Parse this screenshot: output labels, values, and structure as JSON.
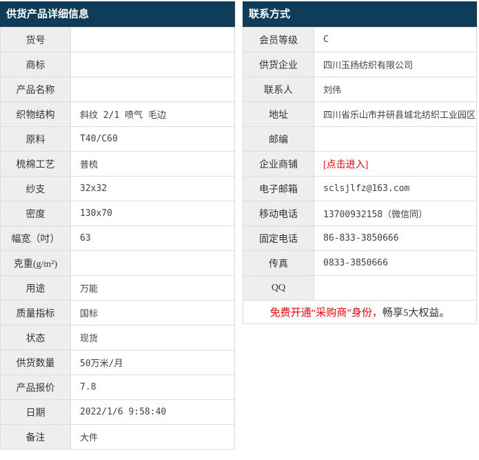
{
  "colors": {
    "header_bg": "#0d3d58",
    "accent_red": "#e60000",
    "label_bg": "#eeeeee",
    "border": "#dcdcdc"
  },
  "left_panel": {
    "title": "供货产品详细信息",
    "rows": [
      {
        "label": "货号",
        "value": ""
      },
      {
        "label": "商标",
        "value": ""
      },
      {
        "label": "产品名称",
        "value": ""
      },
      {
        "label": "织物结构",
        "value": "斜纹 2/1 喷气 毛边"
      },
      {
        "label": "原料",
        "value": "T40/C60"
      },
      {
        "label": "梳棉工艺",
        "value": "普梳"
      },
      {
        "label": "纱支",
        "value": "32x32"
      },
      {
        "label": "密度",
        "value": "130x70"
      },
      {
        "label": "幅宽（吋）",
        "value": "63"
      },
      {
        "label": "克重(g/m²)",
        "value": ""
      },
      {
        "label": "用途",
        "value": "万能"
      },
      {
        "label": "质量指标",
        "value": "国标"
      },
      {
        "label": "状态",
        "value": "现货"
      },
      {
        "label": "供货数量",
        "value": "50万米/月"
      },
      {
        "label": "产品报价",
        "value": "7.8"
      },
      {
        "label": "日期",
        "value": "2022/1/6 9:58:40"
      },
      {
        "label": "备注",
        "value": "大件"
      }
    ]
  },
  "right_panel": {
    "title": "联系方式",
    "rows": [
      {
        "label": "会员等级",
        "value": "C"
      },
      {
        "label": "供货企业",
        "value": "四川玉扬纺织有限公司"
      },
      {
        "label": "联系人",
        "value": "刘伟"
      },
      {
        "label": "地址",
        "value": "四川省乐山市井研县城北纺织工业园区"
      },
      {
        "label": "邮编",
        "value": ""
      },
      {
        "label": "企业商铺",
        "value": "[点击进入]"
      },
      {
        "label": "电子邮箱",
        "value": "sclsjlfz@163.com"
      },
      {
        "label": "移动电话",
        "value": "13700932158（微信同）"
      },
      {
        "label": "固定电话",
        "value": "86-833-3850666"
      },
      {
        "label": "传真",
        "value": "0833-3850666"
      },
      {
        "label": "QQ",
        "value": ""
      }
    ],
    "note": {
      "red": "免费开通“采购商”身份，",
      "dark": "畅享5大权益。"
    }
  }
}
